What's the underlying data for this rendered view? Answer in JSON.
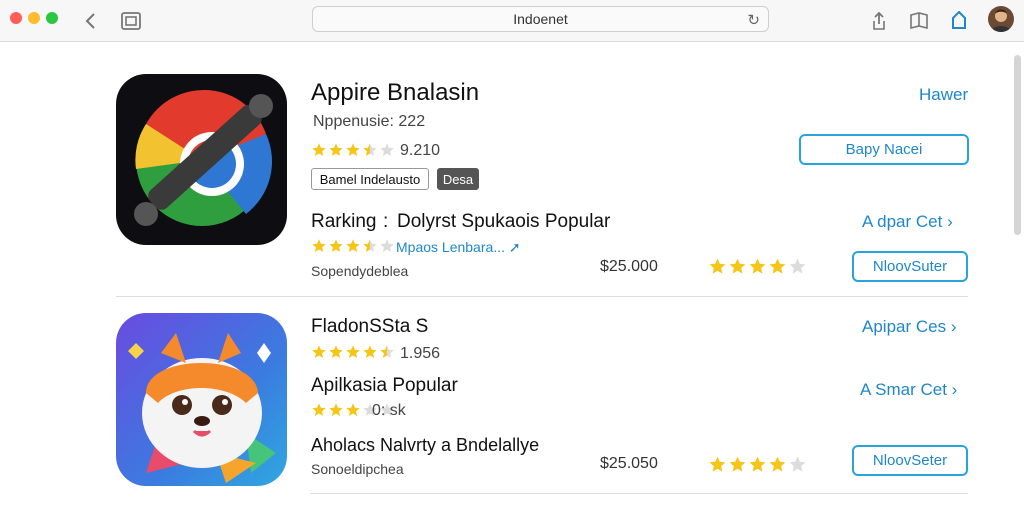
{
  "toolbar": {
    "address_text": "Indoenet",
    "traffic_colors": [
      "#ff5f57",
      "#febc2e",
      "#28c840"
    ]
  },
  "apps": [
    {
      "title": "Appire Bnalasin",
      "subtitle": "Nppenusie: 222",
      "rating": 3.5,
      "rating_text": "9.210",
      "tags": [
        "Bamel Indelausto",
        "Desa"
      ],
      "link_top": "Hawer",
      "button_top": "Bapy Nacei",
      "ranking_label": "Rarking",
      "ranking_sep": ":",
      "ranking_text": "Dolyrst Spukaois Popular",
      "link_mid": "A dpar Cet",
      "sub_rating": 3.5,
      "sub_link": "Mpaos Lenbara...",
      "developer": "Sopendydeblea",
      "price": "$25.000",
      "big_rating": 4,
      "button_bottom": "NloovSuter"
    },
    {
      "title": "FladonSSta S",
      "rating": 4.5,
      "rating_text": "1.956",
      "link_mid": "Apipar Ces",
      "line2": "Apilkasia Popular",
      "link_mid2": "A Smar Cet",
      "sub_rating": 3,
      "sub_rating_text": "0: sk",
      "line3": "Aholacs Nalvrty a Bndelallye",
      "developer": "Sonoeldipchea",
      "price": "$25.050",
      "big_rating": 4,
      "button_bottom": "NloovSeter"
    }
  ]
}
